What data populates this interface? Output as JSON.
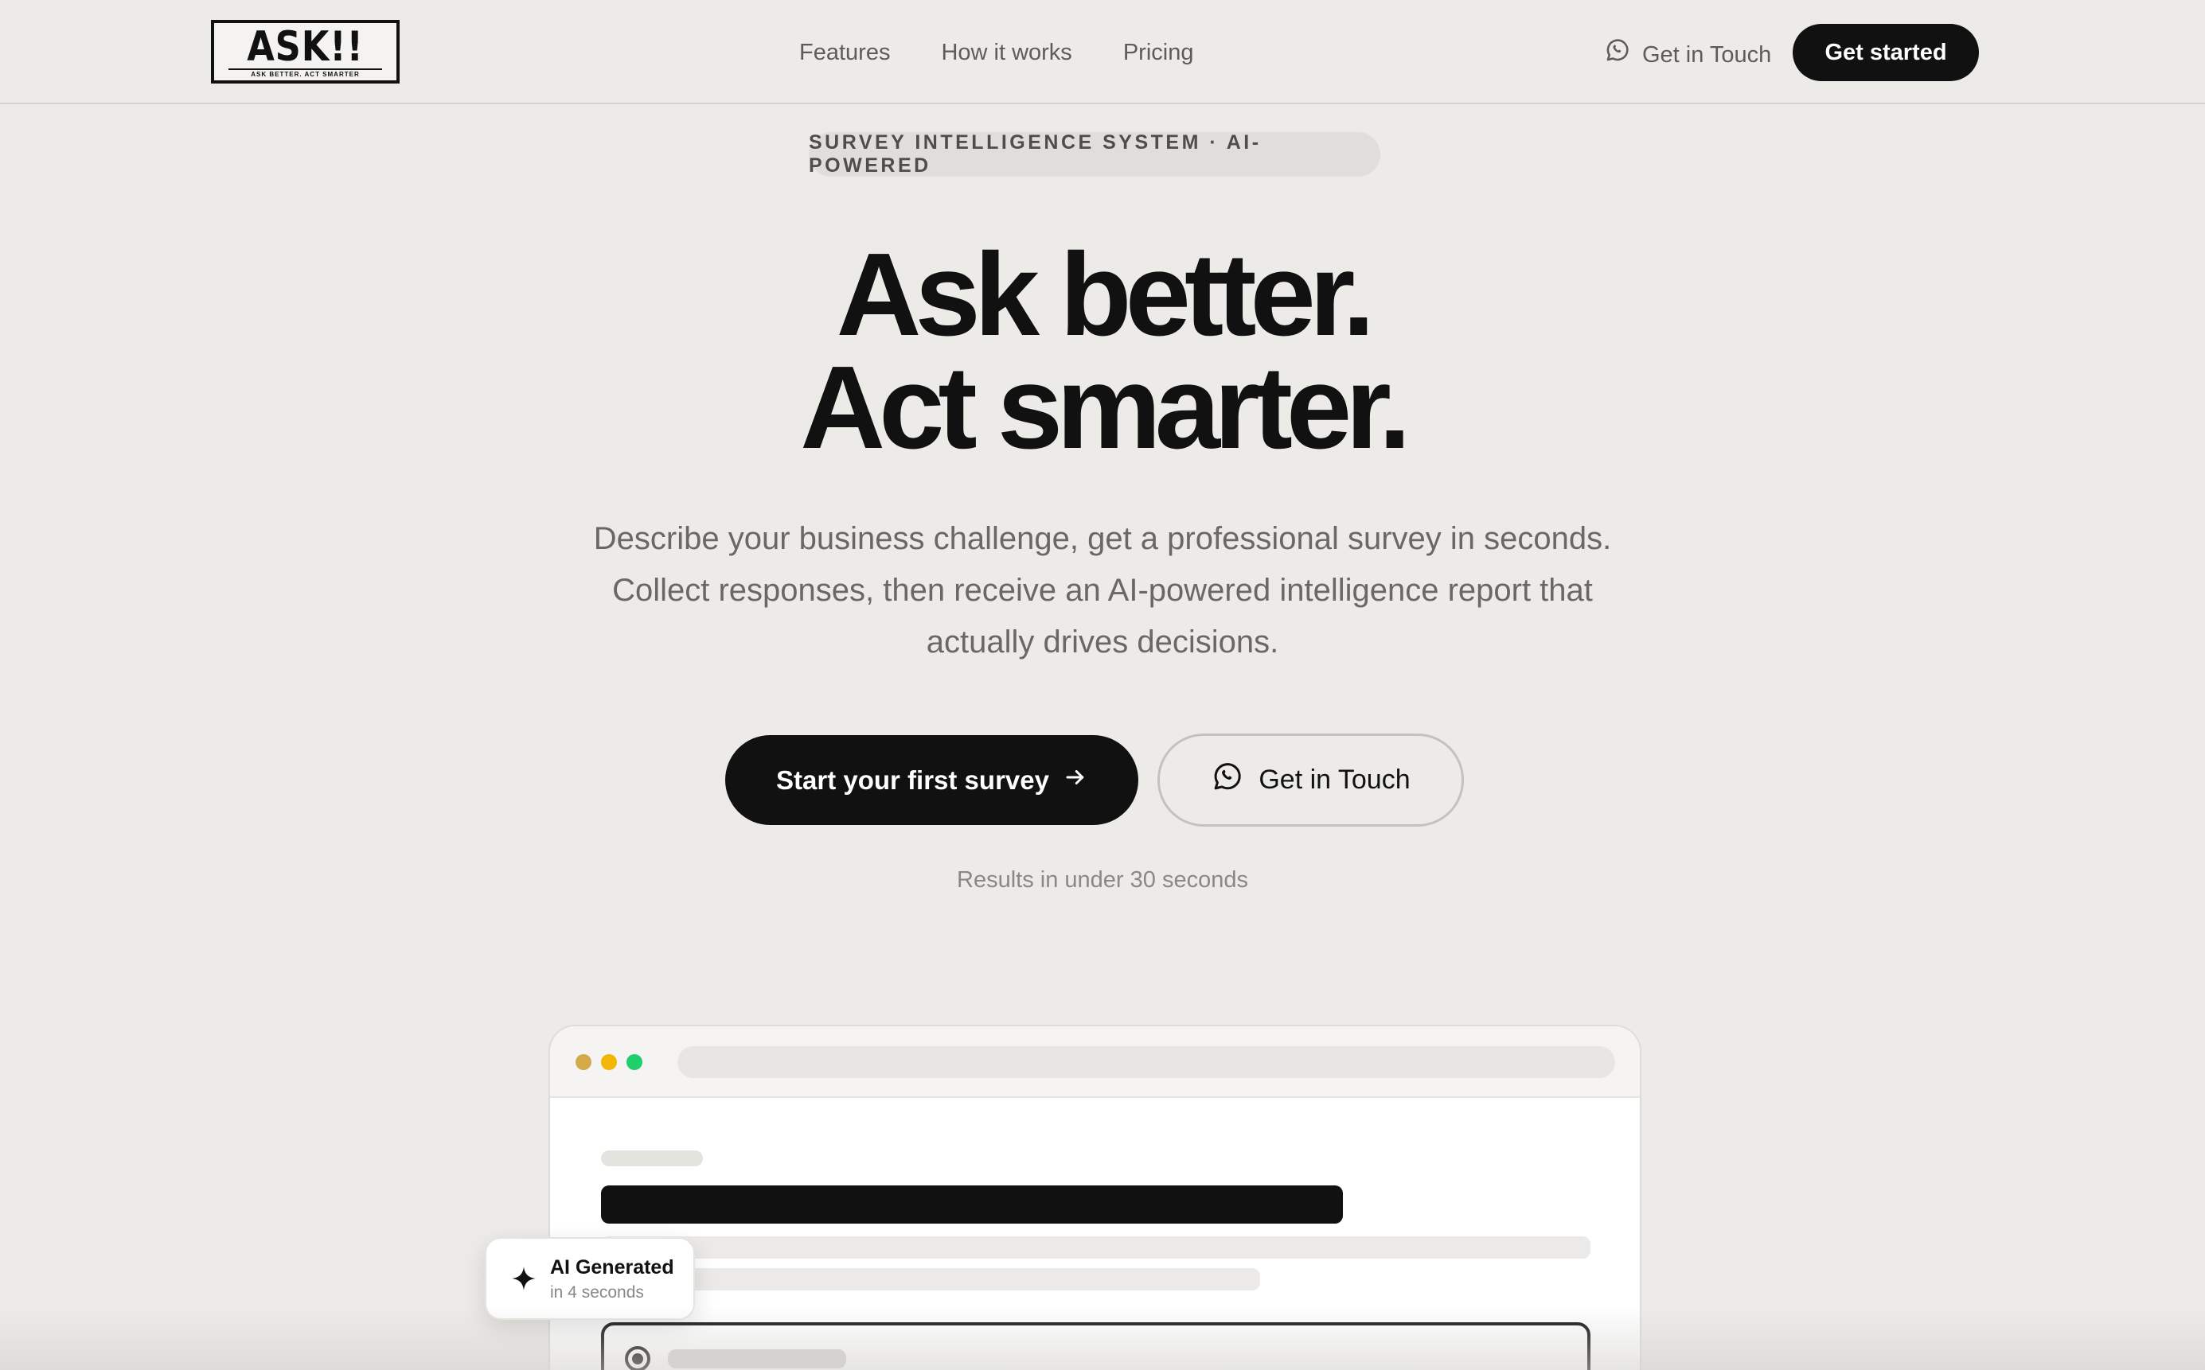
{
  "nav": {
    "logo": {
      "word": "ASK!!",
      "tagline": "ASK BETTER. ACT SMARTER"
    },
    "links": [
      "Features",
      "How it works",
      "Pricing"
    ],
    "contact_label": "Get in Touch",
    "cta_label": "Get started"
  },
  "hero": {
    "badge": "SURVEY INTELLIGENCE SYSTEM · AI-POWERED",
    "headline_line1": "Ask better.",
    "headline_line2": "Act smarter.",
    "subtext": "Describe your business challenge, get a professional survey in seconds. Collect responses, then receive an AI-powered intelligence report that actually drives decisions.",
    "primary_button": "Start your first survey",
    "secondary_button": "Get in Touch",
    "note": "Results in under 30 seconds"
  },
  "mockup": {
    "window_dot_colors": [
      "#d4a94a",
      "#f2b705",
      "#1fcf6b"
    ],
    "ai_card": {
      "title": "AI Generated",
      "subtitle": "in 4 seconds"
    }
  },
  "colors": {
    "background": "#edebe8",
    "primary": "#111111",
    "muted_text": "#6a6864"
  },
  "icons": [
    "whatsapp-icon",
    "arrow-right-icon",
    "sparkle-icon"
  ]
}
